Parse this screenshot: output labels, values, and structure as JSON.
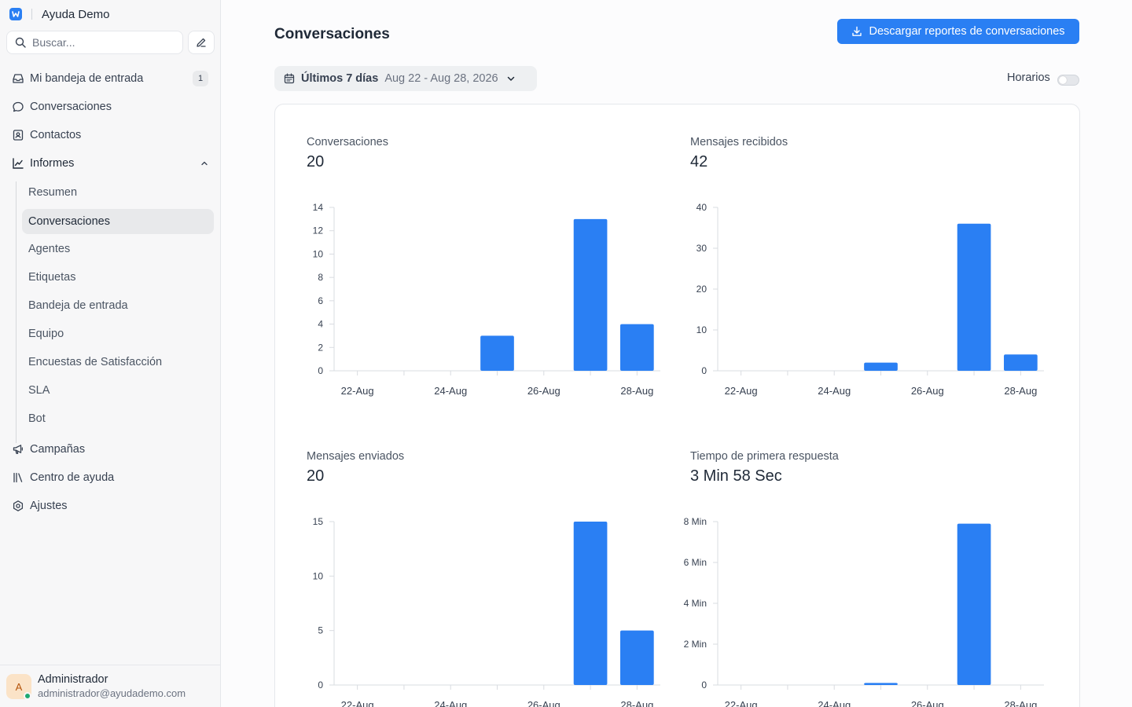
{
  "sidebar": {
    "brand_name": "Ayuda Demo",
    "search_placeholder": "Buscar...",
    "nav": [
      {
        "label": "Mi bandeja de entrada",
        "icon": "inbox-icon",
        "badge": "1"
      },
      {
        "label": "Conversaciones",
        "icon": "chat-bubble-icon"
      },
      {
        "label": "Contactos",
        "icon": "contact-card-icon"
      },
      {
        "label": "Informes",
        "icon": "chart-line-icon",
        "expanded": true
      }
    ],
    "reports": [
      "Resumen",
      "Conversaciones",
      "Agentes",
      "Etiquetas",
      "Bandeja de entrada",
      "Equipo",
      "Encuestas de Satisfacción",
      "SLA",
      "Bot"
    ],
    "active_report": "Conversaciones",
    "bottom_nav": [
      {
        "label": "Campañas",
        "icon": "megaphone-icon"
      },
      {
        "label": "Centro de ayuda",
        "icon": "library-icon"
      },
      {
        "label": "Ajustes",
        "icon": "settings-icon"
      }
    ],
    "profile": {
      "initial": "A",
      "name": "Administrador",
      "email": "administrador@ayudademo.com",
      "status": "online"
    }
  },
  "header": {
    "title": "Conversaciones",
    "download_label": "Descargar reportes de conversaciones"
  },
  "filters": {
    "range_label": "Últimos 7 días",
    "range_dates": "Aug 22 - Aug 28, 2026",
    "business_hours_label": "Horarios",
    "business_hours_enabled": false
  },
  "colors": {
    "accent": "#2A7FF3",
    "bar": "#2A7FF3"
  },
  "metrics": [
    {
      "label": "Conversaciones",
      "value": "20"
    },
    {
      "label": "Mensajes recibidos",
      "value": "42"
    },
    {
      "label": "Mensajes enviados",
      "value": "20"
    },
    {
      "label": "Tiempo de primera respuesta",
      "value": "3 Min 58 Sec"
    }
  ],
  "chart_data": [
    {
      "type": "bar",
      "title": "Conversaciones",
      "categories": [
        "22-Aug",
        "23-Aug",
        "24-Aug",
        "25-Aug",
        "26-Aug",
        "27-Aug",
        "28-Aug"
      ],
      "x_tick_labels": [
        "22-Aug",
        "24-Aug",
        "26-Aug",
        "28-Aug"
      ],
      "values": [
        0,
        0,
        0,
        3,
        0,
        13,
        4
      ],
      "ylim": [
        0,
        14
      ],
      "y_ticks": [
        {
          "v": 0,
          "label": "0"
        },
        {
          "v": 2,
          "label": "2"
        },
        {
          "v": 4,
          "label": "4"
        },
        {
          "v": 6,
          "label": "6"
        },
        {
          "v": 8,
          "label": "8"
        },
        {
          "v": 10,
          "label": "10"
        },
        {
          "v": 12,
          "label": "12"
        },
        {
          "v": 14,
          "label": "14"
        }
      ],
      "grid": false
    },
    {
      "type": "bar",
      "title": "Mensajes recibidos",
      "categories": [
        "22-Aug",
        "23-Aug",
        "24-Aug",
        "25-Aug",
        "26-Aug",
        "27-Aug",
        "28-Aug"
      ],
      "x_tick_labels": [
        "22-Aug",
        "24-Aug",
        "26-Aug",
        "28-Aug"
      ],
      "values": [
        0,
        0,
        0,
        2,
        0,
        36,
        4
      ],
      "ylim": [
        0,
        40
      ],
      "y_ticks": [
        {
          "v": 0,
          "label": "0"
        },
        {
          "v": 10,
          "label": "10"
        },
        {
          "v": 20,
          "label": "20"
        },
        {
          "v": 30,
          "label": "30"
        },
        {
          "v": 40,
          "label": "40"
        }
      ],
      "grid": false
    },
    {
      "type": "bar",
      "title": "Mensajes enviados",
      "categories": [
        "22-Aug",
        "23-Aug",
        "24-Aug",
        "25-Aug",
        "26-Aug",
        "27-Aug",
        "28-Aug"
      ],
      "x_tick_labels": [
        "22-Aug",
        "24-Aug",
        "26-Aug",
        "28-Aug"
      ],
      "values": [
        0,
        0,
        0,
        0,
        0,
        15,
        5
      ],
      "ylim": [
        0,
        15
      ],
      "y_ticks": [
        {
          "v": 0,
          "label": "0"
        },
        {
          "v": 5,
          "label": "5"
        },
        {
          "v": 10,
          "label": "10"
        },
        {
          "v": 15,
          "label": "15"
        }
      ],
      "grid": false
    },
    {
      "type": "bar",
      "title": "Tiempo de primera respuesta",
      "categories": [
        "22-Aug",
        "23-Aug",
        "24-Aug",
        "25-Aug",
        "26-Aug",
        "27-Aug",
        "28-Aug"
      ],
      "x_tick_labels": [
        "22-Aug",
        "24-Aug",
        "26-Aug",
        "28-Aug"
      ],
      "values": [
        0,
        0,
        0,
        0.1,
        0,
        7.9,
        0
      ],
      "unit": "Min",
      "ylim": [
        0,
        8
      ],
      "y_ticks": [
        {
          "v": 0,
          "label": "0"
        },
        {
          "v": 2,
          "label": "2 Min"
        },
        {
          "v": 4,
          "label": "4 Min"
        },
        {
          "v": 6,
          "label": "6 Min"
        },
        {
          "v": 8,
          "label": "8 Min"
        }
      ],
      "grid": false
    }
  ]
}
